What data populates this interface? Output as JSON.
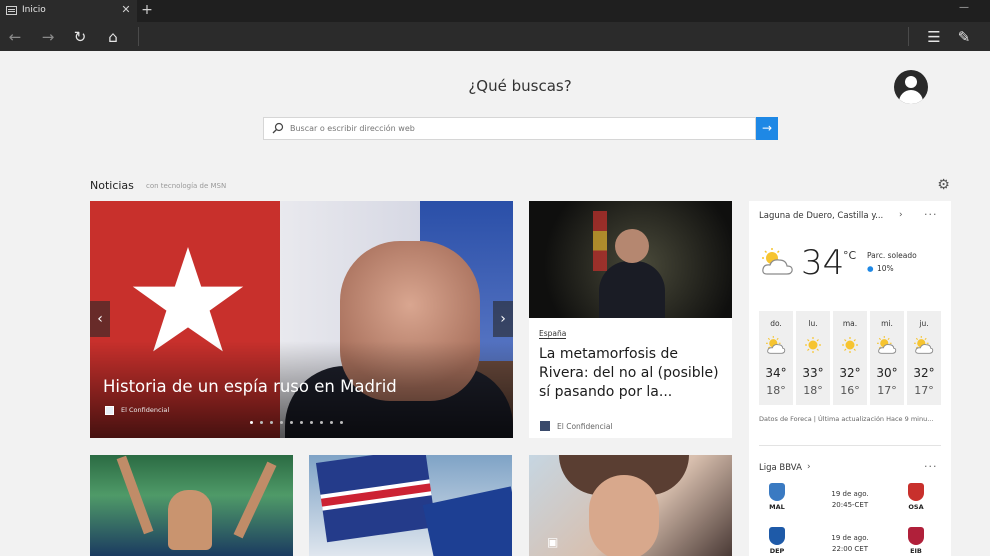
{
  "browser": {
    "tab_title": "Inicio",
    "tab_close": "✕",
    "new_tab": "+",
    "minimize": "—"
  },
  "nav": {
    "back": "←",
    "forward": "→",
    "refresh": "↻",
    "home": "⌂",
    "hub": "☰",
    "note": "✎"
  },
  "page": {
    "headline": "¿Qué buscas?",
    "search_placeholder": "Buscar o escribir dirección web",
    "search_go": "→",
    "news_label": "Noticias",
    "news_sub": "con tecnología de MSN",
    "settings": "⚙"
  },
  "hero": {
    "title": "Historia de un espía ruso en Madrid",
    "source": "El Confidencial",
    "prev": "‹",
    "next": "›",
    "slides": 10,
    "active_slide": 0
  },
  "article": {
    "category": "España",
    "title": "La metamorfosis de Rivera: del no al (posible) sí pasando por la...",
    "source": "El Confidencial"
  },
  "weather": {
    "location": "Laguna de Duero, Castilla y...",
    "chevron": "›",
    "more": "···",
    "temp": "34",
    "unit": "°C",
    "condition": "Parc. soleado",
    "rain": "10%",
    "rain_icon": "💧",
    "forecast": [
      {
        "day": "do.",
        "hi": "34°",
        "lo": "18°",
        "icon": "partly-sunny-icon"
      },
      {
        "day": "lu.",
        "hi": "33°",
        "lo": "18°",
        "icon": "sunny-icon"
      },
      {
        "day": "ma.",
        "hi": "32°",
        "lo": "16°",
        "icon": "sunny-icon"
      },
      {
        "day": "mi.",
        "hi": "30°",
        "lo": "17°",
        "icon": "partly-sunny-icon"
      },
      {
        "day": "ju.",
        "hi": "32°",
        "lo": "17°",
        "icon": "partly-sunny-icon"
      }
    ],
    "footer": "Datos de Foreca | Última actualización Hace 9 minu..."
  },
  "liga": {
    "title": "Liga BBVA",
    "chevron": "›",
    "more": "···",
    "matches": [
      {
        "home": "MAL",
        "away": "OSA",
        "date": "19 de ago.",
        "time": "20:45-CET",
        "home_color": "#3a7ac2",
        "away_color": "#c8302c"
      },
      {
        "home": "DEP",
        "away": "EIB",
        "date": "19 de ago.",
        "time": "22:00 CET",
        "home_color": "#1e5aa8",
        "away_color": "#b0203a"
      }
    ]
  },
  "colors": {
    "accent": "#1e88e5",
    "chrome": "#2b2b2b"
  }
}
